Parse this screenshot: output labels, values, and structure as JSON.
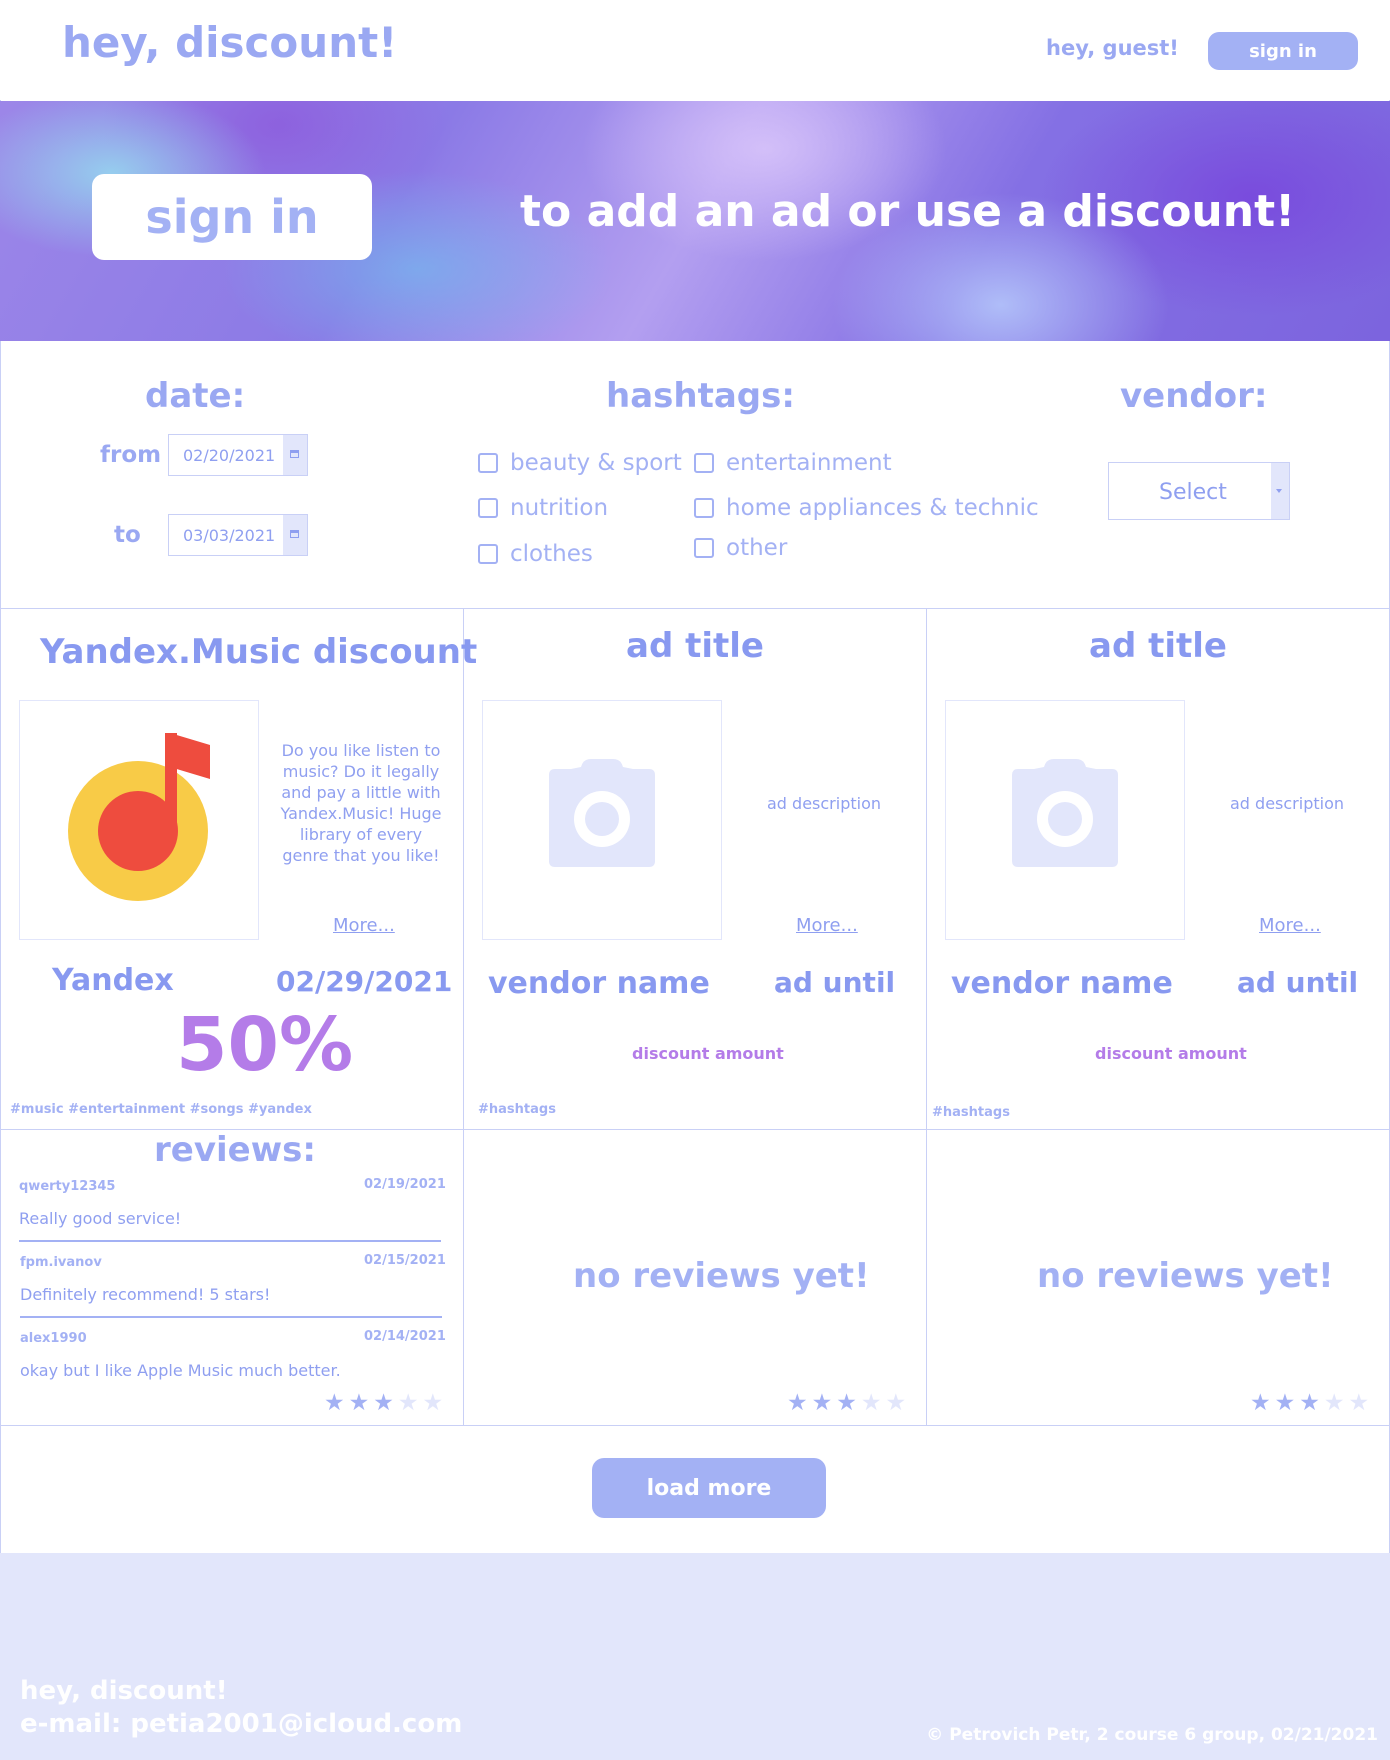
{
  "header": {
    "logo": "hey, discount!",
    "greeting": "hey, guest!",
    "signin_label": "sign in"
  },
  "banner": {
    "signin_label": "sign in",
    "text": "to add an ad or use a discount!"
  },
  "filters": {
    "date_label": "date:",
    "from_label": "from",
    "from_value": "02/20/2021",
    "to_label": "to",
    "to_value": "03/03/2021",
    "hashtags_label": "hashtags:",
    "hashtags": [
      "beauty & sport",
      "entertainment",
      "nutrition",
      "home appliances & technic",
      "clothes",
      "other"
    ],
    "vendor_label": "vendor:",
    "vendor_value": "Select"
  },
  "cards": [
    {
      "title": "Yandex.Music discount",
      "description": "Do you like listen to music? Do it legally and pay a little with Yandex.Music! Huge library of every genre that you like!",
      "more": "More...",
      "vendor": "Yandex",
      "until": "02/29/2021",
      "discount": "50%",
      "hashtags": "#music #entertainment #songs #yandex",
      "image_icon": "yandex-music-logo",
      "rating": 3
    },
    {
      "title": "ad title",
      "description": "ad description",
      "more": "More...",
      "vendor": "vendor name",
      "until": "ad until",
      "discount": "discount amount",
      "hashtags": "#hashtags",
      "image_icon": "camera-icon",
      "rating": 3
    },
    {
      "title": "ad title",
      "description": "ad description",
      "more": "More...",
      "vendor": "vendor name",
      "until": "ad until",
      "discount": "discount amount",
      "hashtags": "#hashtags",
      "image_icon": "camera-icon",
      "rating": 3
    }
  ],
  "reviews": {
    "title": "reviews:",
    "items": [
      {
        "user": "qwerty12345",
        "date": "02/19/2021",
        "text": "Really good service!"
      },
      {
        "user": "fpm.ivanov",
        "date": "02/15/2021",
        "text": "Definitely recommend! 5 stars!"
      },
      {
        "user": "alex1990",
        "date": "02/14/2021",
        "text": "okay but I like Apple Music much better."
      }
    ],
    "empty_text": "no reviews yet!",
    "max_stars": 5
  },
  "load_more_label": "load more",
  "footer": {
    "title": "hey, discount!",
    "email": "e-mail: petia2001@icloud.com",
    "copyright": "© Petrovich Petr, 2 course 6 group, 02/21/2021"
  },
  "colors": {
    "accent": "#a3b1f4",
    "discount": "#b47ce8",
    "footer_bg": "#e2e6fb"
  }
}
